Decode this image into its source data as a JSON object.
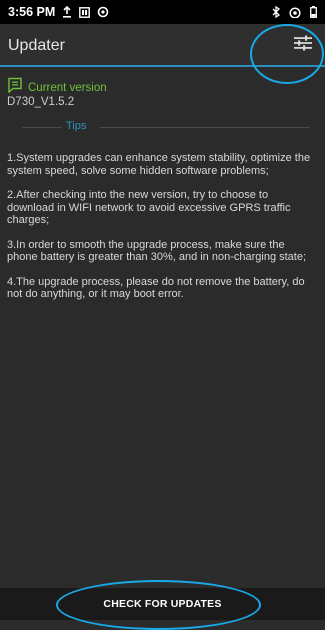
{
  "status_bar": {
    "time": "3:56 PM",
    "icons": [
      "upload-icon",
      "sim-card-icon",
      "data-saver-icon",
      "bluetooth-icon",
      "wifi-icon",
      "battery-icon"
    ]
  },
  "app_bar": {
    "title": "Updater",
    "settings_icon": "tune-settings-icon",
    "accent_color": "#2a8fbd"
  },
  "version": {
    "label": "Current version",
    "value": "D730_V1.5.2",
    "label_color": "#6fc23a"
  },
  "tips": {
    "heading": "Tips",
    "items": [
      "1.System upgrades can enhance system stability, optimize the system speed, solve some hidden software problems;",
      "2.After checking into the new version, try to choose to download in WIFI network to avoid excessive GPRS traffic charges;",
      "3.In order to smooth the upgrade process, make sure the phone battery is greater than 30%, and in non-charging state;",
      "4.The upgrade process, please do not remove the battery, do not do anything, or it may boot error."
    ]
  },
  "footer": {
    "button_label": "CHECK FOR UPDATES"
  }
}
